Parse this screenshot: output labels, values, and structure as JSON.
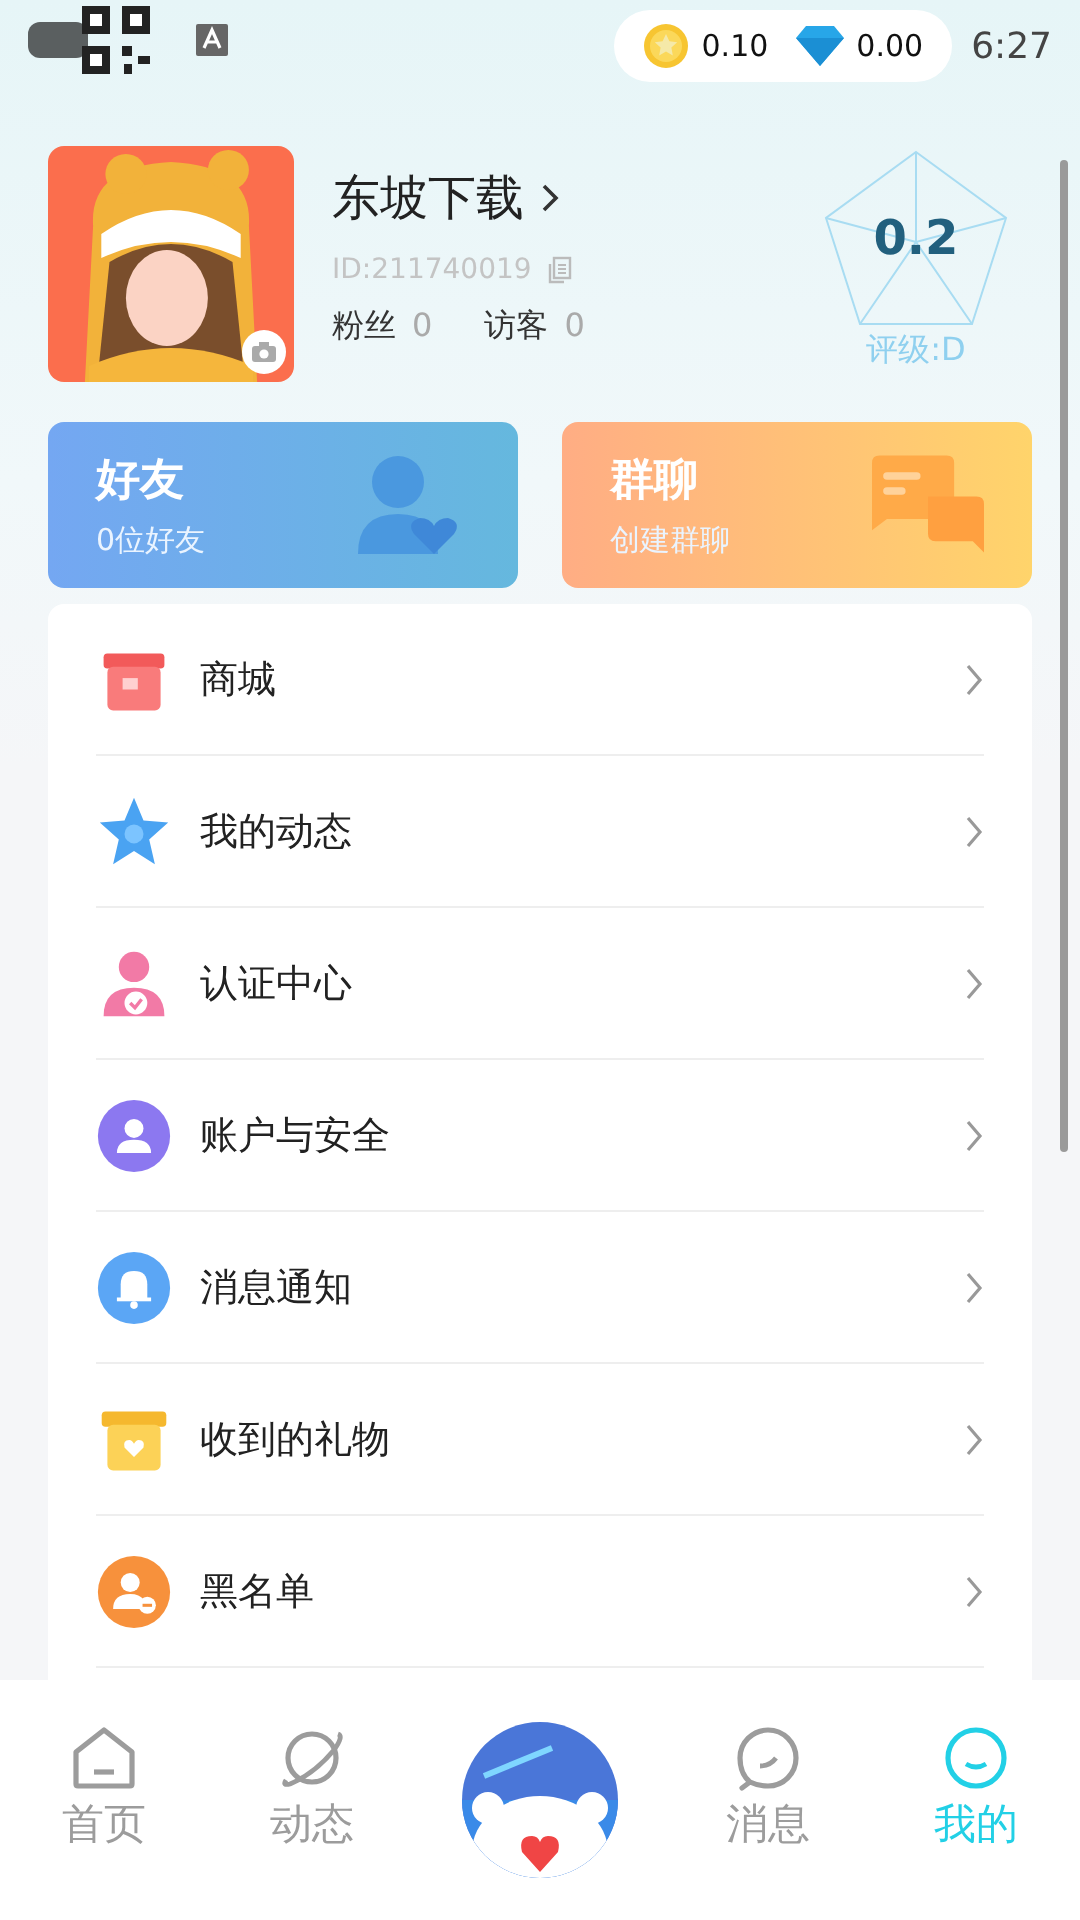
{
  "status_bar": {
    "coins": "0.10",
    "diamonds": "0.00",
    "time": "6:27"
  },
  "profile": {
    "name": "东坡下载",
    "id": "ID:211740019",
    "followers_label": "粉丝",
    "followers": "0",
    "visitors_label": "访客",
    "visitors": "0",
    "score": "0.2",
    "rating": "评级:D"
  },
  "cards": [
    {
      "title": "好友",
      "subtitle": "0位好友"
    },
    {
      "title": "群聊",
      "subtitle": "创建群聊"
    }
  ],
  "menu": [
    {
      "label": "商城"
    },
    {
      "label": "我的动态"
    },
    {
      "label": "认证中心"
    },
    {
      "label": "账户与安全"
    },
    {
      "label": "消息通知"
    },
    {
      "label": "收到的礼物"
    },
    {
      "label": "黑名单"
    }
  ],
  "nav": [
    {
      "label": "首页",
      "selected": false
    },
    {
      "label": "动态",
      "selected": false
    },
    {
      "kind": "picture"
    },
    {
      "label": "消息",
      "selected": false
    },
    {
      "label": "我的",
      "selected": true
    }
  ]
}
